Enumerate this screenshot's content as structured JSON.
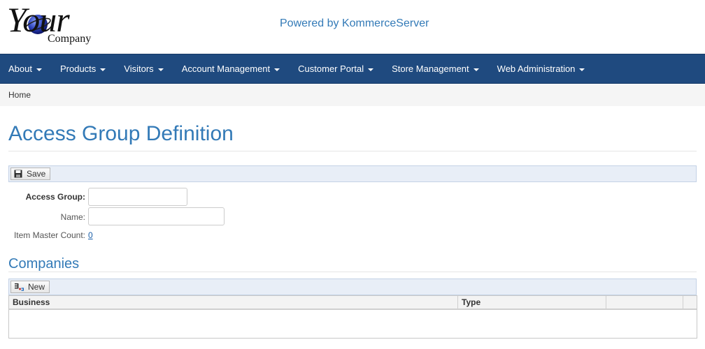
{
  "header": {
    "logo_word": "Your",
    "logo_sub": "Company",
    "powered_by": "Powered by KommerceServer"
  },
  "nav": {
    "items": [
      {
        "label": "About"
      },
      {
        "label": "Products"
      },
      {
        "label": "Visitors"
      },
      {
        "label": "Account Management"
      },
      {
        "label": "Customer Portal"
      },
      {
        "label": "Store Management"
      },
      {
        "label": "Web Administration"
      }
    ]
  },
  "breadcrumb": {
    "home": "Home"
  },
  "page": {
    "title": "Access Group Definition"
  },
  "toolbar": {
    "save_label": "Save"
  },
  "form": {
    "access_group_label": "Access Group:",
    "access_group_value": "",
    "name_label": "Name:",
    "name_value": "",
    "item_master_label": "Item Master Count:",
    "item_master_count": "0"
  },
  "companies": {
    "title": "Companies",
    "new_label": "New",
    "columns": [
      "Business",
      "Type",
      "",
      ""
    ]
  },
  "colors": {
    "nav_bg": "#1f4a7f",
    "accent": "#337ab7",
    "toolbar_bg": "#e8eef7"
  },
  "icons": {
    "save": "floppy-disk-icon",
    "new": "new-record-icon",
    "caret": "caret-down-icon"
  }
}
